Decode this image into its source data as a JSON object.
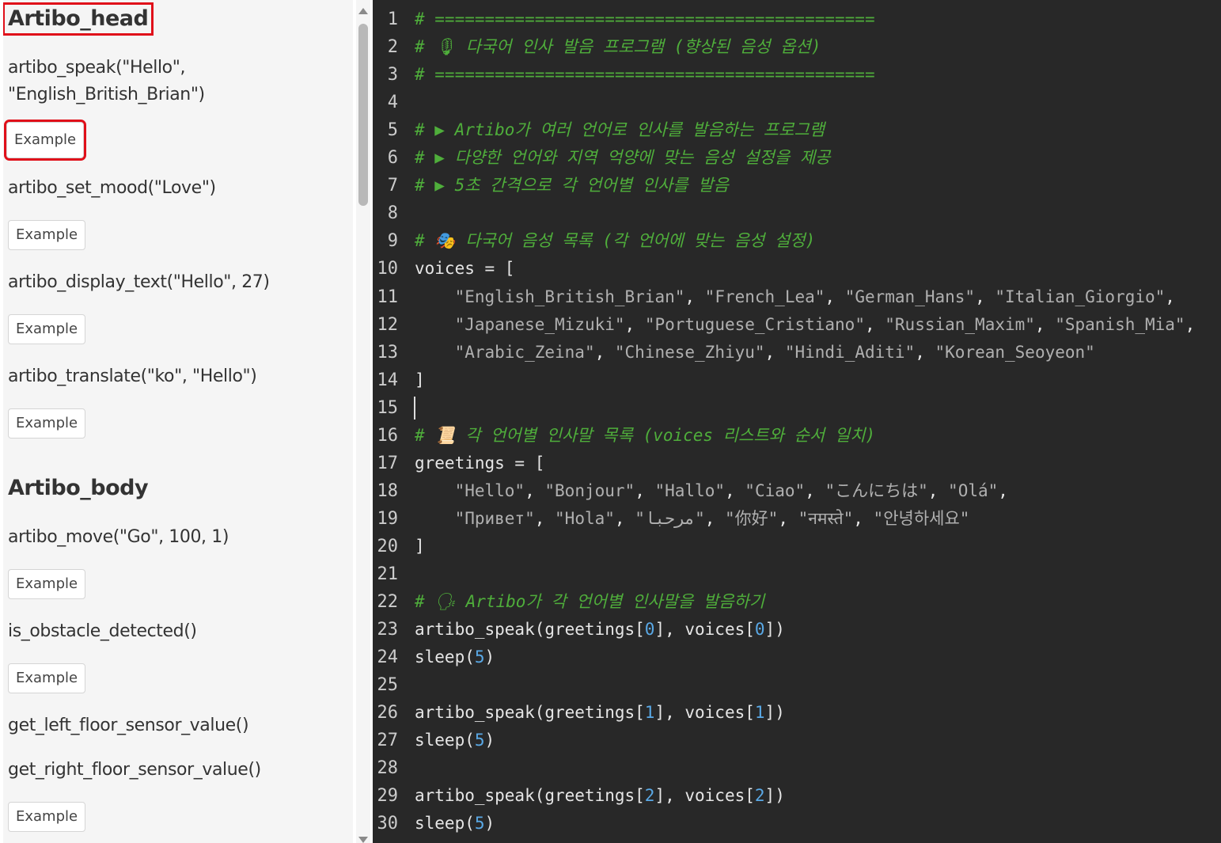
{
  "sidebar": {
    "head_title": "Artibo_head",
    "body_title": "Artibo_body",
    "example_label": "Example",
    "functions": {
      "speak_line1": "artibo_speak(\"Hello\",",
      "speak_line2": "\"English_British_Brian\")",
      "set_mood": "artibo_set_mood(\"Love\")",
      "display_text": "artibo_display_text(\"Hello\", 27)",
      "translate": "artibo_translate(\"ko\", \"Hello\")",
      "move": "artibo_move(\"Go\", 100, 1)",
      "obstacle": "is_obstacle_detected()",
      "left_floor": "get_left_floor_sensor_value()",
      "right_floor": "get_right_floor_sensor_value()"
    }
  },
  "editor": {
    "line_numbers": [
      "1",
      "2",
      "3",
      "4",
      "5",
      "6",
      "7",
      "8",
      "9",
      "10",
      "11",
      "12",
      "13",
      "14",
      "15",
      "16",
      "17",
      "18",
      "19",
      "20",
      "21",
      "22",
      "23",
      "24",
      "25",
      "26",
      "27",
      "28",
      "29",
      "30"
    ],
    "lines": [
      [
        {
          "t": "cmt",
          "v": "# ============================================"
        }
      ],
      [
        {
          "t": "cmt",
          "v": "# 🎙 다국어 인사 발음 프로그램 (향상된 음성 옵션)"
        }
      ],
      [
        {
          "t": "cmt",
          "v": "# ============================================"
        }
      ],
      [],
      [
        {
          "t": "cmt",
          "v": "# ▶ Artibo가 여러 언어로 인사를 발음하는 프로그램"
        }
      ],
      [
        {
          "t": "cmt",
          "v": "# ▶ 다양한 언어와 지역 억양에 맞는 음성 설정을 제공"
        }
      ],
      [
        {
          "t": "cmt",
          "v": "# ▶ 5초 간격으로 각 언어별 인사를 발음"
        }
      ],
      [],
      [
        {
          "t": "cmt",
          "v": "# 🎭 다국어 음성 목록 (각 언어에 맞는 음성 설정)"
        }
      ],
      [
        {
          "t": "txt",
          "v": "voices = ["
        }
      ],
      [
        {
          "t": "txt",
          "v": "    "
        },
        {
          "t": "str",
          "v": "\"English_British_Brian\""
        },
        {
          "t": "txt",
          "v": ", "
        },
        {
          "t": "str",
          "v": "\"French_Lea\""
        },
        {
          "t": "txt",
          "v": ", "
        },
        {
          "t": "str",
          "v": "\"German_Hans\""
        },
        {
          "t": "txt",
          "v": ", "
        },
        {
          "t": "str",
          "v": "\"Italian_Giorgio\""
        },
        {
          "t": "txt",
          "v": ","
        }
      ],
      [
        {
          "t": "txt",
          "v": "    "
        },
        {
          "t": "str",
          "v": "\"Japanese_Mizuki\""
        },
        {
          "t": "txt",
          "v": ", "
        },
        {
          "t": "str",
          "v": "\"Portuguese_Cristiano\""
        },
        {
          "t": "txt",
          "v": ", "
        },
        {
          "t": "str",
          "v": "\"Russian_Maxim\""
        },
        {
          "t": "txt",
          "v": ", "
        },
        {
          "t": "str",
          "v": "\"Spanish_Mia\""
        },
        {
          "t": "txt",
          "v": ","
        }
      ],
      [
        {
          "t": "txt",
          "v": "    "
        },
        {
          "t": "str",
          "v": "\"Arabic_Zeina\""
        },
        {
          "t": "txt",
          "v": ", "
        },
        {
          "t": "str",
          "v": "\"Chinese_Zhiyu\""
        },
        {
          "t": "txt",
          "v": ", "
        },
        {
          "t": "str",
          "v": "\"Hindi_Aditi\""
        },
        {
          "t": "txt",
          "v": ", "
        },
        {
          "t": "str",
          "v": "\"Korean_Seoyeon\""
        }
      ],
      [
        {
          "t": "txt",
          "v": "]"
        }
      ],
      [],
      [
        {
          "t": "cmt",
          "v": "# 📜 각 언어별 인사말 목록 (voices 리스트와 순서 일치)"
        }
      ],
      [
        {
          "t": "txt",
          "v": "greetings = ["
        }
      ],
      [
        {
          "t": "txt",
          "v": "    "
        },
        {
          "t": "str",
          "v": "\"Hello\""
        },
        {
          "t": "txt",
          "v": ", "
        },
        {
          "t": "str",
          "v": "\"Bonjour\""
        },
        {
          "t": "txt",
          "v": ", "
        },
        {
          "t": "str",
          "v": "\"Hallo\""
        },
        {
          "t": "txt",
          "v": ", "
        },
        {
          "t": "str",
          "v": "\"Ciao\""
        },
        {
          "t": "txt",
          "v": ", "
        },
        {
          "t": "str",
          "v": "\"こんにちは\""
        },
        {
          "t": "txt",
          "v": ", "
        },
        {
          "t": "str",
          "v": "\"Olá\""
        },
        {
          "t": "txt",
          "v": ","
        }
      ],
      [
        {
          "t": "txt",
          "v": "    "
        },
        {
          "t": "str",
          "v": "\"Привет\""
        },
        {
          "t": "txt",
          "v": ", "
        },
        {
          "t": "str",
          "v": "\"Hola\""
        },
        {
          "t": "txt",
          "v": ", "
        },
        {
          "t": "str",
          "v": "\"مرحبا\""
        },
        {
          "t": "txt",
          "v": ", "
        },
        {
          "t": "str",
          "v": "\"你好\""
        },
        {
          "t": "txt",
          "v": ", "
        },
        {
          "t": "str",
          "v": "\"नमस्ते\""
        },
        {
          "t": "txt",
          "v": ", "
        },
        {
          "t": "str",
          "v": "\"안녕하세요\""
        }
      ],
      [
        {
          "t": "txt",
          "v": "]"
        }
      ],
      [],
      [
        {
          "t": "cmt",
          "v": "# 🗣 Artibo가 각 언어별 인사말을 발음하기"
        }
      ],
      [
        {
          "t": "txt",
          "v": "artibo_speak(greetings["
        },
        {
          "t": "num",
          "v": "0"
        },
        {
          "t": "txt",
          "v": "], voices["
        },
        {
          "t": "num",
          "v": "0"
        },
        {
          "t": "txt",
          "v": "])"
        }
      ],
      [
        {
          "t": "txt",
          "v": "sleep("
        },
        {
          "t": "num",
          "v": "5"
        },
        {
          "t": "txt",
          "v": ")"
        }
      ],
      [],
      [
        {
          "t": "txt",
          "v": "artibo_speak(greetings["
        },
        {
          "t": "num",
          "v": "1"
        },
        {
          "t": "txt",
          "v": "], voices["
        },
        {
          "t": "num",
          "v": "1"
        },
        {
          "t": "txt",
          "v": "])"
        }
      ],
      [
        {
          "t": "txt",
          "v": "sleep("
        },
        {
          "t": "num",
          "v": "5"
        },
        {
          "t": "txt",
          "v": ")"
        }
      ],
      [],
      [
        {
          "t": "txt",
          "v": "artibo_speak(greetings["
        },
        {
          "t": "num",
          "v": "2"
        },
        {
          "t": "txt",
          "v": "], voices["
        },
        {
          "t": "num",
          "v": "2"
        },
        {
          "t": "txt",
          "v": "])"
        }
      ],
      [
        {
          "t": "txt",
          "v": "sleep("
        },
        {
          "t": "num",
          "v": "5"
        },
        {
          "t": "txt",
          "v": ")"
        }
      ]
    ]
  }
}
